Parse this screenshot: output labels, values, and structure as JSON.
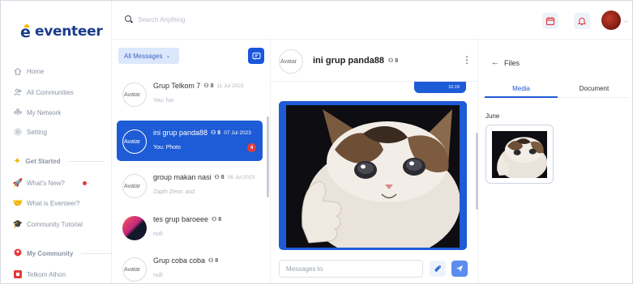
{
  "app": {
    "name": "eventeer"
  },
  "sidebar": {
    "nav": [
      {
        "label": "Home",
        "icon": "home-icon"
      },
      {
        "label": "All Communities",
        "icon": "people-icon"
      },
      {
        "label": "My Network",
        "icon": "network-icon"
      },
      {
        "label": "Setting",
        "icon": "gear-icon"
      }
    ],
    "get_started": {
      "title": "Get Started",
      "items": [
        {
          "label": "What's New?",
          "icon": "rocket-icon"
        },
        {
          "label": "What is Eventeer?",
          "icon": "handshake-icon"
        },
        {
          "label": "Community Tutorial",
          "icon": "graduation-cap-icon"
        }
      ]
    },
    "my_community": {
      "title": "My Community",
      "items": [
        {
          "label": "Telkom Athon"
        }
      ]
    }
  },
  "topbar": {
    "search_placeholder": "Search Anything"
  },
  "chatlist": {
    "filter": "All Messages",
    "chats": [
      {
        "name": "Grup Telkom 7",
        "members": "8",
        "date": "11 Jul 2023",
        "last": "You: hai",
        "avatar": "Avatar",
        "active": false
      },
      {
        "name": "ini grup panda88",
        "members": "8",
        "date": "07 Jul 2023",
        "last": "You: Photo",
        "avatar": "Avatar",
        "active": true,
        "unread": "4"
      },
      {
        "name": "group makan nasi",
        "members": "8",
        "date": "06 Jul 2023",
        "last": "Zapth Zeno: asd",
        "avatar": "Avatar",
        "active": false
      },
      {
        "name": "tes grup baroeee",
        "members": "8",
        "date": "",
        "last": "null:",
        "avatar": "",
        "active": false
      },
      {
        "name": "Grup coba coba",
        "members": "8",
        "date": "",
        "last": "null:",
        "avatar": "Avatar",
        "active": false
      }
    ]
  },
  "conversation": {
    "title": "ini grup panda88",
    "members": "8",
    "avatar": "Avatar",
    "last_time": "10.19",
    "composer_placeholder": "Messages to"
  },
  "files": {
    "back_label": "Files",
    "tabs": [
      "Media",
      "Document"
    ],
    "active_tab": "Media",
    "month": "June"
  },
  "colors": {
    "brand": "#1a3c8c",
    "accent": "#1e5bd6",
    "badge": "#e23c3c"
  }
}
